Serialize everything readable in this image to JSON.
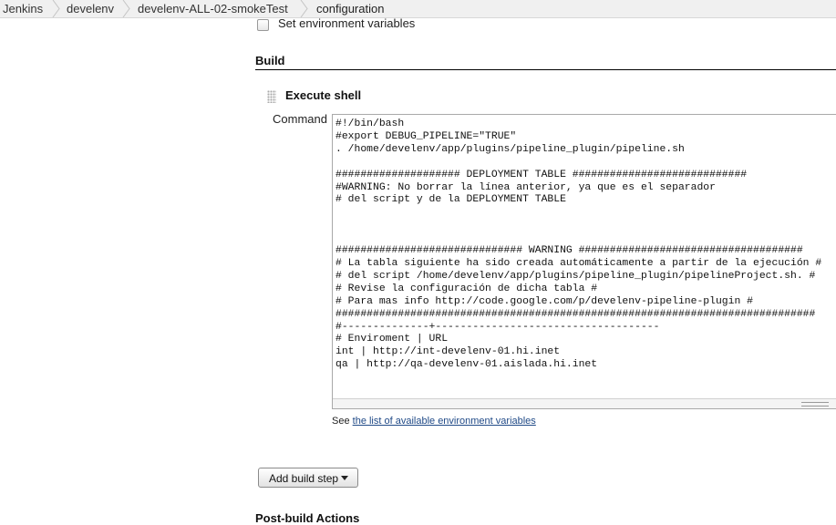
{
  "breadcrumbs": [
    "Jenkins",
    "develenv",
    "develenv-ALL-02-smokeTest",
    "configuration"
  ],
  "env_checkbox": {
    "label": "Set environment variables",
    "checked": false
  },
  "build_section": {
    "title": "Build"
  },
  "build_step": {
    "title": "Execute shell",
    "command_label": "Command",
    "command_lines": [
      "#!/bin/bash",
      "#export DEBUG_PIPELINE=\"TRUE\"",
      ". /home/develenv/app/plugins/pipeline_plugin/pipeline.sh",
      "",
      "#################### DEPLOYMENT TABLE ############################",
      "#WARNING: No borrar la línea anterior, ya que es el separador",
      "# del script y de la DEPLOYMENT TABLE",
      "",
      "",
      "",
      "############################## WARNING ####################################",
      "# La tabla siguiente ha sido creada automáticamente a partir de la ejecución #",
      "# del script /home/develenv/app/plugins/pipeline_plugin/pipelineProject.sh. #",
      "# Revise la configuración de dicha tabla #",
      "# Para mas info http://code.google.com/p/develenv-pipeline-plugin #",
      "#############################################################################",
      "#--------------+------------------------------------",
      "# Enviroment | URL",
      "int | http://int-develenv-01.hi.inet",
      "qa | http://qa-develenv-01.aislada.hi.inet"
    ],
    "see_prefix": "See ",
    "see_link": "the list of available environment variables"
  },
  "add_build_step": {
    "label": "Add build step"
  },
  "post_build": {
    "title": "Post-build Actions"
  }
}
